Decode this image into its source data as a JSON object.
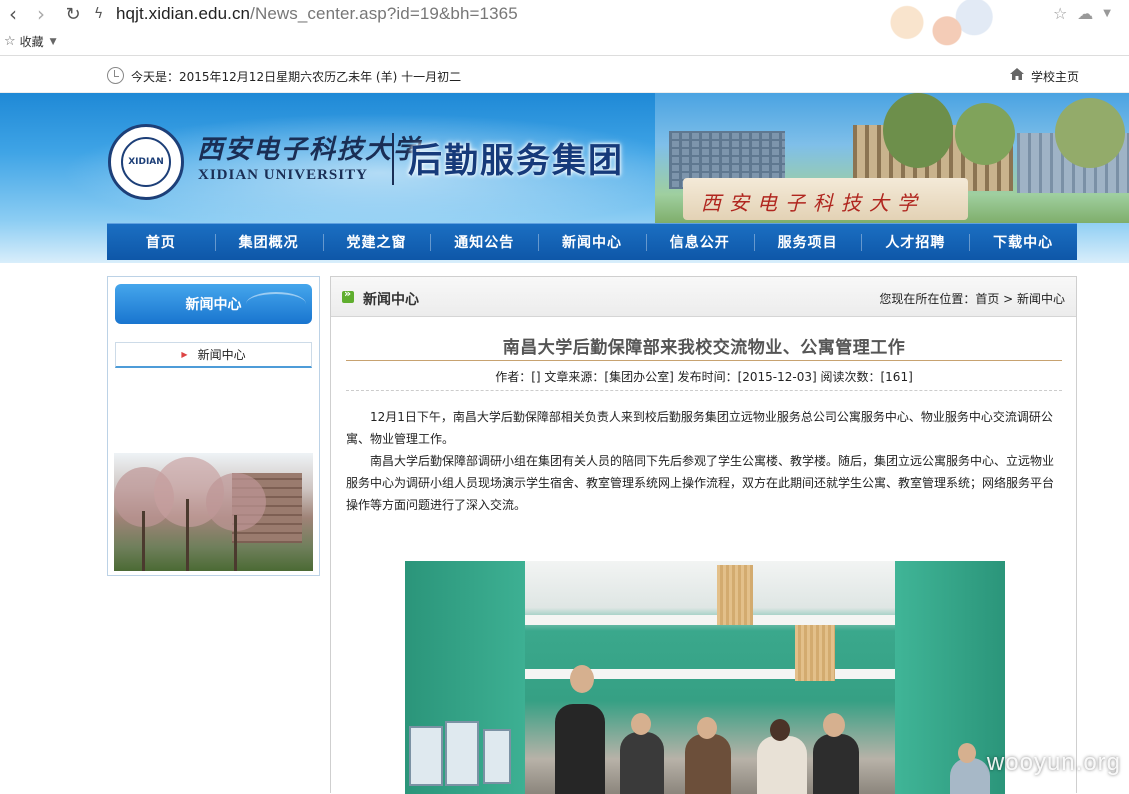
{
  "browser": {
    "url_host": "hqjt.xidian.edu.cn",
    "url_path": "/News_center.asp?id=19&bh=1365",
    "favorites_label": "收藏"
  },
  "topbar": {
    "date_text": "今天是：2015年12月12日星期六农历乙未年 (羊) 十一月初二",
    "home_link": "学校主页"
  },
  "banner": {
    "university_cn": "西安电子科技大学",
    "university_en": "XIDIAN UNIVERSITY",
    "group_name": "后勤服务集团",
    "stone_text": "西安电子科技大学",
    "seal_text": "XIDIAN"
  },
  "nav": {
    "items": [
      "首页",
      "集团概况",
      "党建之窗",
      "通知公告",
      "新闻中心",
      "信息公开",
      "服务项目",
      "人才招聘",
      "下载中心"
    ]
  },
  "sidebar": {
    "header": "新闻中心",
    "item": "新闻中心"
  },
  "content": {
    "section_title": "新闻中心",
    "breadcrumb": "您现在所在位置：首页 > 新闻中心",
    "article_title": "南昌大学后勤保障部来我校交流物业、公寓管理工作",
    "meta": "作者：[] 文章来源：[集团办公室] 发布时间：[2015-12-03] 阅读次数：[161]",
    "paragraphs": [
      "12月1日下午，南昌大学后勤保障部相关负责人来到校后勤服务集团立远物业服务总公司公寓服务中心、物业服务中心交流调研公寓、物业管理工作。",
      "南昌大学后勤保障部调研小组在集团有关人员的陪同下先后参观了学生公寓楼、教学楼。随后，集团立远公寓服务中心、立远物业服务中心为调研小组人员现场演示学生宿舍、教室管理系统网上操作流程，双方在此期间还就学生公寓、教室管理系统；网络服务平台操作等方面问题进行了深入交流。"
    ]
  },
  "watermark": "wooyun.org",
  "colors": {
    "nav_bg": "#0e57a8",
    "banner_top": "#1f89d6",
    "rule": "#c7a270",
    "bullet": "#5fae2e"
  }
}
